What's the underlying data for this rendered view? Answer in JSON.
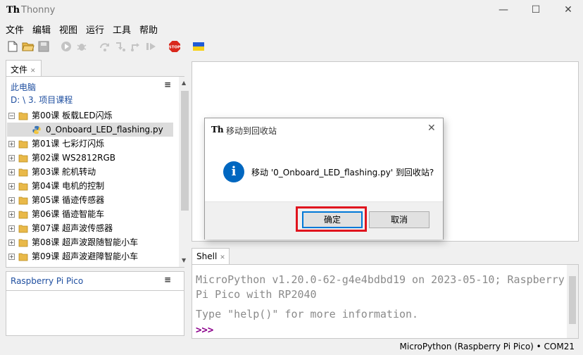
{
  "window": {
    "title": "Thonny",
    "logo": "Th"
  },
  "menubar": [
    "文件",
    "编辑",
    "视图",
    "运行",
    "工具",
    "帮助"
  ],
  "toolbar": {
    "icons": [
      "new-file-icon",
      "open-folder-icon",
      "save-icon",
      "run-icon",
      "debug-icon",
      "step-over-icon",
      "step-into-icon",
      "step-out-icon",
      "resume-icon",
      "stop-icon",
      "ukraine-flag-icon"
    ],
    "stop_label": "STOP"
  },
  "files": {
    "tab_label": "文件",
    "computer_label": "此电脑",
    "path": "D: \\ 3. 项目课程",
    "tree": [
      {
        "label": "第00课 板载LED闪烁",
        "expanded": true
      },
      {
        "label": "0_Onboard_LED_flashing.py",
        "selected": true
      },
      {
        "label": "第01课 七彩灯闪烁"
      },
      {
        "label": "第02课 WS2812RGB"
      },
      {
        "label": "第03课 舵机转动"
      },
      {
        "label": "第04课 电机的控制"
      },
      {
        "label": "第05课 循迹传感器"
      },
      {
        "label": "第06课 循迹智能车"
      },
      {
        "label": "第07课 超声波传感器"
      },
      {
        "label": "第08课 超声波跟随智能小车"
      },
      {
        "label": "第09课 超声波避障智能小车"
      }
    ],
    "expand_symbol": "+",
    "collapse_symbol": "−"
  },
  "device": {
    "title": "Raspberry Pi Pico"
  },
  "shell": {
    "tab_label": "Shell",
    "line1": "MicroPython v1.20.0-62-g4e4bdbd19 on 2023-05-10; Raspberry",
    "line2": "Pi Pico with RP2040",
    "line3": "Type \"help()\" for more information.",
    "prompt": ">>>"
  },
  "statusbar": {
    "text": "MicroPython (Raspberry Pi Pico)  •  COM21"
  },
  "dialog": {
    "title": "移动到回收站",
    "message": "移动 '0_Onboard_LED_flashing.py' 到回收站?",
    "ok_label": "确定",
    "cancel_label": "取消",
    "info_glyph": "i"
  },
  "colors": {
    "accent": "#0078d7",
    "info": "#0067c0",
    "highlight": "#e0141e",
    "prompt": "#8b008b"
  }
}
